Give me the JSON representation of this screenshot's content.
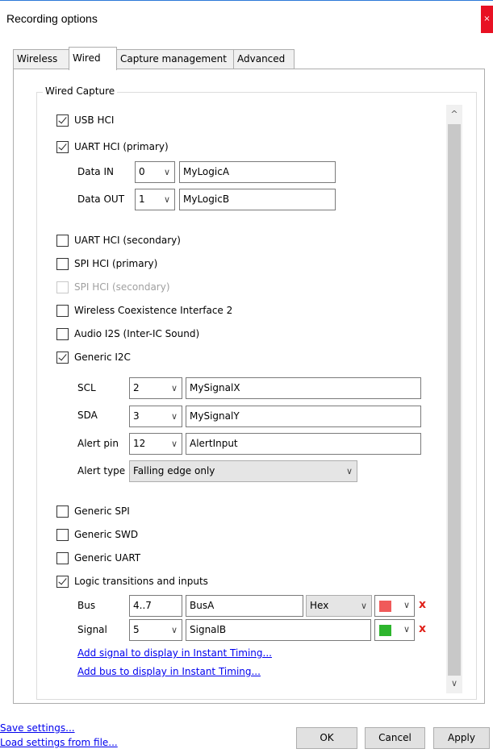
{
  "window": {
    "title": "Recording options",
    "close_icon": "close-icon"
  },
  "tabs": [
    {
      "label": "Wireless"
    },
    {
      "label": "Wired",
      "active": true
    },
    {
      "label": "Capture management"
    },
    {
      "label": "Advanced"
    }
  ],
  "group": {
    "label": "Wired Capture"
  },
  "options": {
    "usb_hci": {
      "label": "USB HCI",
      "checked": true
    },
    "uart_hci_primary": {
      "label": "UART HCI (primary)",
      "checked": true
    },
    "uart_hci_secondary": {
      "label": "UART HCI (secondary)",
      "checked": false
    },
    "spi_hci_primary": {
      "label": "SPI HCI (primary)",
      "checked": false
    },
    "spi_hci_secondary": {
      "label": "SPI HCI (secondary)",
      "checked": false,
      "disabled": true
    },
    "wci2": {
      "label": "Wireless Coexistence Interface 2",
      "checked": false
    },
    "audio_i2s": {
      "label": "Audio I2S (Inter-IC Sound)",
      "checked": false
    },
    "generic_i2c": {
      "label": "Generic I2C",
      "checked": true
    },
    "generic_spi": {
      "label": "Generic SPI",
      "checked": false
    },
    "generic_swd": {
      "label": "Generic SWD",
      "checked": false
    },
    "generic_uart": {
      "label": "Generic UART",
      "checked": false
    },
    "logic_transitions": {
      "label": "Logic transitions and inputs",
      "checked": true
    }
  },
  "uart_fields": {
    "data_in": {
      "label": "Data IN",
      "channel": "0",
      "name": "MyLogicA"
    },
    "data_out": {
      "label": "Data OUT",
      "channel": "1",
      "name": "MyLogicB"
    }
  },
  "i2c_fields": {
    "scl": {
      "label": "SCL",
      "channel": "2",
      "name": "MySignalX"
    },
    "sda": {
      "label": "SDA",
      "channel": "3",
      "name": "MySignalY"
    },
    "alert_pin": {
      "label": "Alert pin",
      "channel": "12",
      "name": "AlertInput"
    },
    "alert_type": {
      "label": "Alert type",
      "value": "Falling edge only"
    }
  },
  "logic_fields": {
    "bus": {
      "label": "Bus",
      "range": "4..7",
      "name": "BusA",
      "format": "Hex",
      "color": "#f05a5a"
    },
    "signal": {
      "label": "Signal",
      "channel": "5",
      "name": "SignalB",
      "color": "#2db52d"
    }
  },
  "links": {
    "add_signal": "Add signal to display in Instant Timing...",
    "add_bus": "Add bus to display in Instant Timing..."
  },
  "footer": {
    "save_settings": "Save settings...",
    "load_settings": "Load settings from file...",
    "ok": "OK",
    "cancel": "Cancel",
    "apply": "Apply"
  },
  "glyphs": {
    "chevron": "∨",
    "up": "^",
    "down": "∨",
    "remove": "x",
    "close": "×"
  }
}
